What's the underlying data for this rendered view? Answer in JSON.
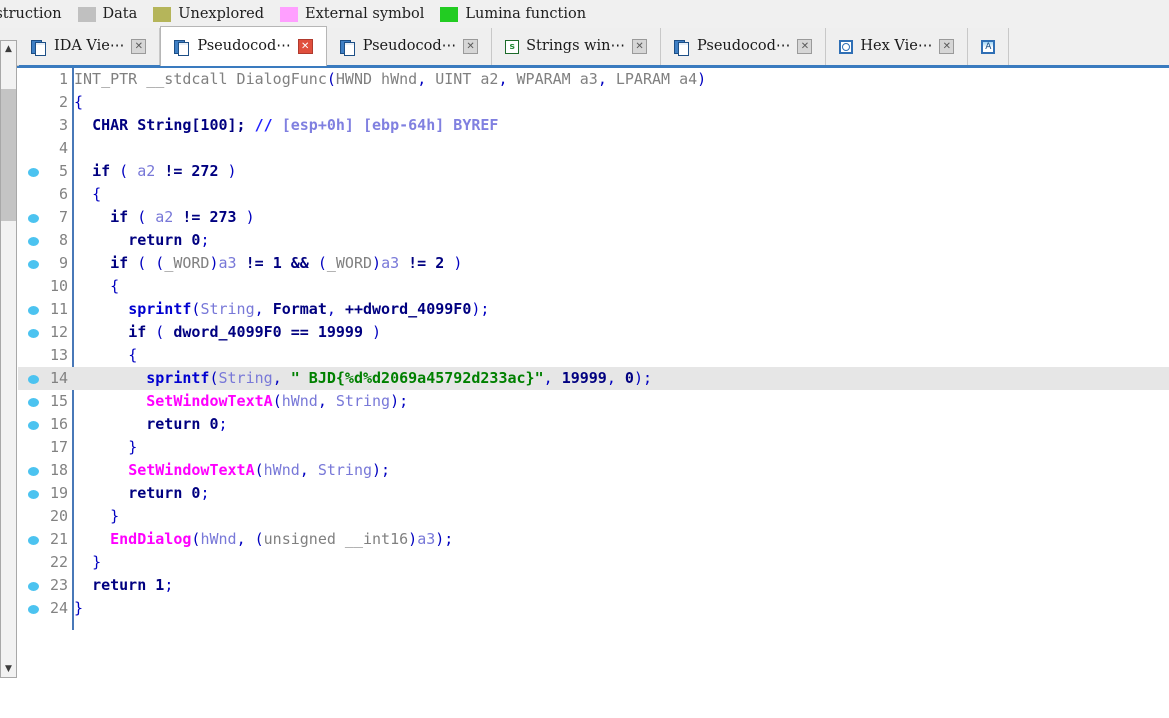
{
  "legend": {
    "items": [
      {
        "label": "nstruction",
        "color": "",
        "truncated_left": true
      },
      {
        "label": "Data",
        "color": "#c0c0c0"
      },
      {
        "label": "Unexplored",
        "color": "#b5b55a"
      },
      {
        "label": "External symbol",
        "color": "#ff9fff"
      },
      {
        "label": "Lumina function",
        "color": "#22cc22"
      }
    ]
  },
  "tabbar": {
    "close_left_icon": "✕",
    "tabs": [
      {
        "title": "IDA Vie⋯",
        "icon": "document-icon",
        "active": false,
        "close": "✕"
      },
      {
        "title": "Pseudocod⋯",
        "icon": "document-icon",
        "active": true,
        "close": "✕"
      },
      {
        "title": "Pseudocod⋯",
        "icon": "document-icon",
        "active": false,
        "close": "✕"
      },
      {
        "title": "Strings win⋯",
        "icon": "strings-icon",
        "active": false,
        "close": "✕",
        "icon_glyph": "s"
      },
      {
        "title": "Pseudocod⋯",
        "icon": "document-icon",
        "active": false,
        "close": "✕"
      },
      {
        "title": "Hex Vie⋯",
        "icon": "hex-icon",
        "active": false,
        "close": "✕"
      },
      {
        "title": "",
        "icon": "assembly-icon",
        "active": false,
        "close": "",
        "icon_glyph": "A"
      }
    ]
  },
  "scrollbar": {
    "up_arrow": "▲",
    "down_arrow": "▼"
  },
  "code": {
    "lines": [
      {
        "n": "1",
        "bp": false,
        "html": "<span class='t-type'>INT_PTR __stdcall DialogFunc</span><span class='t-punct'>(</span><span class='t-type'>HWND hWnd</span><span class='t-punct'>,</span><span class='t-type'> UINT a2</span><span class='t-punct'>,</span><span class='t-type'> WPARAM a3</span><span class='t-punct'>,</span><span class='t-type'> LPARAM a4</span><span class='t-punct'>)</span>"
      },
      {
        "n": "2",
        "bp": false,
        "html": "<span class='t-punct'>{</span>"
      },
      {
        "n": "3",
        "bp": false,
        "html": "  <span class='t-kw'>CHAR String[100];</span> <span class='t-cmt'>//</span> <span class='t-cmt2'>[esp+0h] [ebp-64h] BYREF</span>"
      },
      {
        "n": "4",
        "bp": false,
        "html": ""
      },
      {
        "n": "5",
        "bp": true,
        "html": "  <span class='t-kw'>if</span> <span class='t-punct'>(</span> <span class='t-local'>a2</span> <span class='t-kw'>!=</span> <span class='t-num'>272</span> <span class='t-punct'>)</span>"
      },
      {
        "n": "6",
        "bp": false,
        "html": "  <span class='t-punct'>{</span>"
      },
      {
        "n": "7",
        "bp": true,
        "html": "    <span class='t-kw'>if</span> <span class='t-punct'>(</span> <span class='t-local'>a2</span> <span class='t-kw'>!=</span> <span class='t-num'>273</span> <span class='t-punct'>)</span>"
      },
      {
        "n": "8",
        "bp": true,
        "html": "      <span class='t-kw'>return</span> <span class='t-num'>0</span><span class='t-punct'>;</span>"
      },
      {
        "n": "9",
        "bp": true,
        "html": "    <span class='t-kw'>if</span> <span class='t-punct'>(</span> <span class='t-punct'>(</span><span class='t-type'>_WORD</span><span class='t-punct'>)</span><span class='t-local'>a3</span> <span class='t-kw'>!=</span> <span class='t-num'>1</span> <span class='t-kw'>&amp;&amp;</span> <span class='t-punct'>(</span><span class='t-type'>_WORD</span><span class='t-punct'>)</span><span class='t-local'>a3</span> <span class='t-kw'>!=</span> <span class='t-num'>2</span> <span class='t-punct'>)</span>"
      },
      {
        "n": "10",
        "bp": false,
        "html": "    <span class='t-punct'>{</span>"
      },
      {
        "n": "11",
        "bp": true,
        "html": "      <span class='t-func'>sprintf</span><span class='t-punct'>(</span><span class='t-local'>String</span><span class='t-punct'>,</span> <span class='t-glob'>Format</span><span class='t-punct'>,</span> <span class='t-kw'>++</span><span class='t-glob'>dword_4099F0</span><span class='t-punct'>);</span>"
      },
      {
        "n": "12",
        "bp": true,
        "html": "      <span class='t-kw'>if</span> <span class='t-punct'>(</span> <span class='t-glob'>dword_4099F0</span> <span class='t-kw'>==</span> <span class='t-num'>19999</span> <span class='t-punct'>)</span>"
      },
      {
        "n": "13",
        "bp": false,
        "html": "      <span class='t-punct'>{</span>"
      },
      {
        "n": "14",
        "bp": true,
        "highlight": true,
        "html": "        <span class='t-func'>sprintf</span><span class='t-punct'>(</span><span class='t-local'>String</span><span class='t-punct'>,</span> <span class='t-str'>\" BJD{%d%d2069a45792d233ac}\"</span><span class='t-punct'>,</span> <span class='t-num'>19999</span><span class='t-punct'>,</span> <span class='t-num'>0</span><span class='t-punct'>);</span>"
      },
      {
        "n": "15",
        "bp": true,
        "html": "        <span class='t-api'>SetWindowTextA</span><span class='t-punct'>(</span><span class='t-local'>hWnd</span><span class='t-punct'>,</span> <span class='t-local'>String</span><span class='t-punct'>);</span>"
      },
      {
        "n": "16",
        "bp": true,
        "html": "        <span class='t-kw'>return</span> <span class='t-num'>0</span><span class='t-punct'>;</span>"
      },
      {
        "n": "17",
        "bp": false,
        "html": "      <span class='t-punct'>}</span>"
      },
      {
        "n": "18",
        "bp": true,
        "html": "      <span class='t-api'>SetWindowTextA</span><span class='t-punct'>(</span><span class='t-local'>hWnd</span><span class='t-punct'>,</span> <span class='t-local'>String</span><span class='t-punct'>);</span>"
      },
      {
        "n": "19",
        "bp": true,
        "html": "      <span class='t-kw'>return</span> <span class='t-num'>0</span><span class='t-punct'>;</span>"
      },
      {
        "n": "20",
        "bp": false,
        "html": "    <span class='t-punct'>}</span>"
      },
      {
        "n": "21",
        "bp": true,
        "html": "    <span class='t-api'>EndDialog</span><span class='t-punct'>(</span><span class='t-local'>hWnd</span><span class='t-punct'>,</span> <span class='t-punct'>(</span><span class='t-type'>unsigned __int16</span><span class='t-punct'>)</span><span class='t-local'>a3</span><span class='t-punct'>);</span>"
      },
      {
        "n": "22",
        "bp": false,
        "html": "  <span class='t-punct'>}</span>"
      },
      {
        "n": "23",
        "bp": true,
        "html": "  <span class='t-kw'>return</span> <span class='t-num'>1</span><span class='t-punct'>;</span>"
      },
      {
        "n": "24",
        "bp": true,
        "html": "<span class='t-punct'>}</span>"
      }
    ]
  }
}
